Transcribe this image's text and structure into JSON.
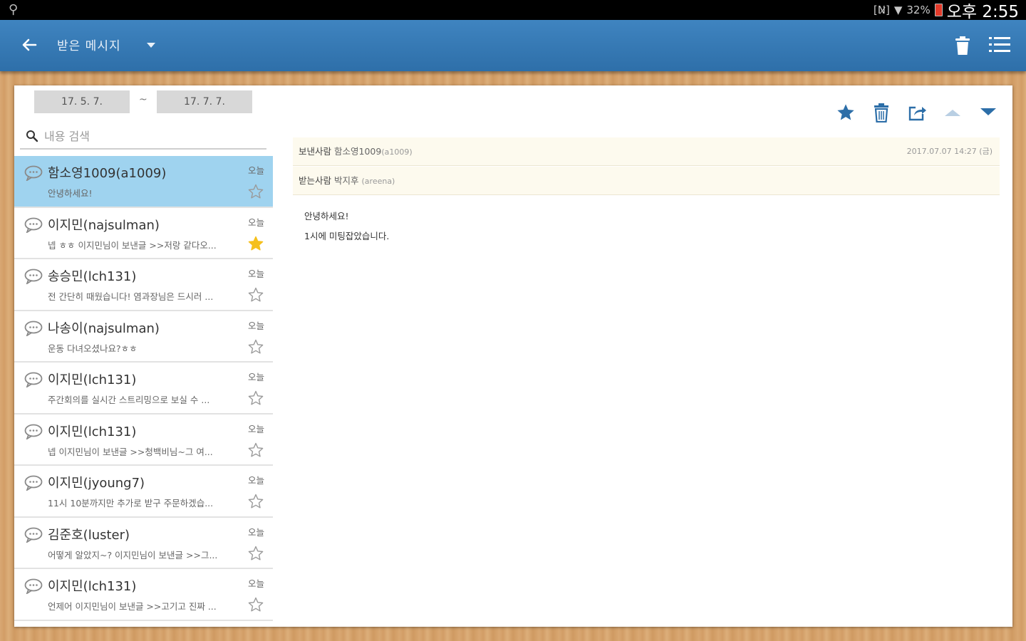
{
  "status_bar": {
    "signal_text": "[N̷]",
    "battery_percent": "32%",
    "time": "오후 2:55"
  },
  "action_bar": {
    "title": "받은 메시지",
    "icons": [
      "back-arrow-icon",
      "dropdown-icon",
      "trash-icon",
      "list-menu-icon"
    ]
  },
  "filter": {
    "date_from": "17. 5. 7.",
    "date_separator": "~",
    "date_to": "17. 7. 7.",
    "search_placeholder": "내용 검색"
  },
  "messages": [
    {
      "sender": "함소영1009(a1009)",
      "preview": "안녕하세요!",
      "day": "오늘",
      "starred": false,
      "selected": true
    },
    {
      "sender": "이지민(najsulman)",
      "preview": "넵 ㅎㅎ 이지민님이 보낸글 >>저랑 같다오...",
      "day": "오늘",
      "starred": true,
      "selected": false
    },
    {
      "sender": "송승민(lch131)",
      "preview": "전 간단히 때웠습니다! 염과장님은 드시러 ...",
      "day": "오늘",
      "starred": false,
      "selected": false
    },
    {
      "sender": "나송이(najsulman)",
      "preview": "운동 다녀오셨나요?ㅎㅎ",
      "day": "오늘",
      "starred": false,
      "selected": false
    },
    {
      "sender": "이지민(lch131)",
      "preview": "주간회의를 실시간 스트리밍으로 보실 수 ...",
      "day": "오늘",
      "starred": false,
      "selected": false
    },
    {
      "sender": "이지민(lch131)",
      "preview": "넵 이지민님이 보낸글 >>청백비님~그 여...",
      "day": "오늘",
      "starred": false,
      "selected": false
    },
    {
      "sender": "이지민(jyoung7)",
      "preview": "11시 10분까지만 추가로 받구 주문하겠습...",
      "day": "오늘",
      "starred": false,
      "selected": false
    },
    {
      "sender": "김준호(luster)",
      "preview": "어떻게 알았지~? 이지민님이 보낸글 >>그...",
      "day": "오늘",
      "starred": false,
      "selected": false
    },
    {
      "sender": "이지민(lch131)",
      "preview": "언제어 이지민님이 보낸글 >>고기고 진짜 ...",
      "day": "오늘",
      "starred": false,
      "selected": false
    }
  ],
  "detail": {
    "toolbar_icons": [
      "star-icon",
      "trash-icon",
      "share-icon",
      "arrow-up-icon",
      "arrow-down-icon"
    ],
    "sender_label": "보낸사람",
    "sender_name": "함소영1009",
    "sender_id": "(a1009)",
    "date": "2017.07.07 14:27 (금)",
    "receiver_label": "받는사람",
    "receiver_name": "박지후",
    "receiver_id": "(areena)",
    "body_line1": "안녕하세요!",
    "body_line2": "1시에 미팅잡았습니다."
  },
  "colors": {
    "action_bar": "#2e6fa9",
    "selected_row": "#9fd3ef",
    "star_active": "#f5c01c",
    "toolbar_icon": "#2c6ea8"
  }
}
